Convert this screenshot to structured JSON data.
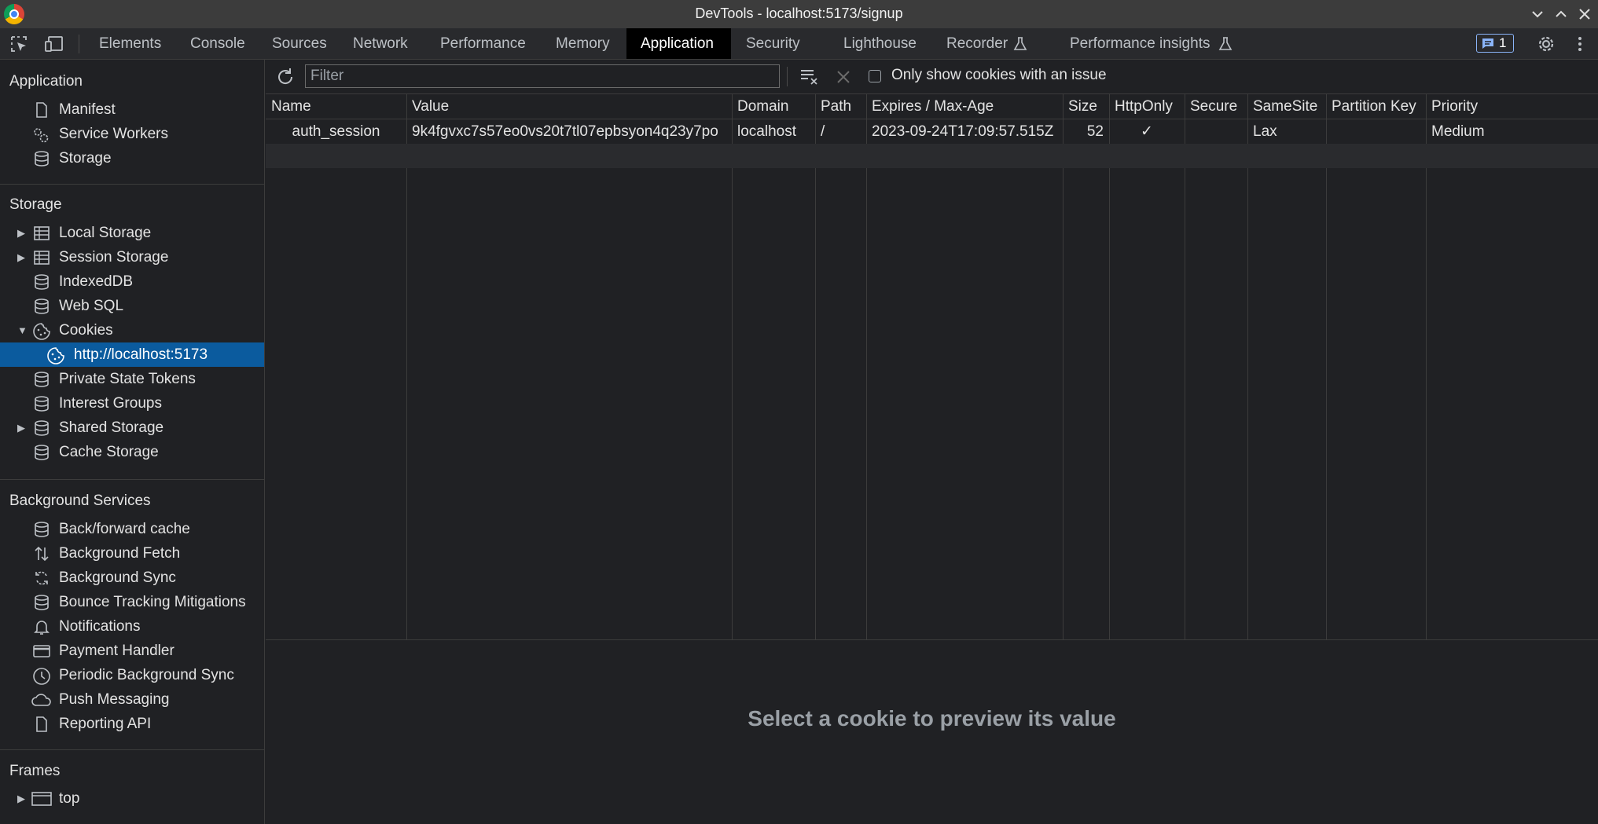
{
  "window": {
    "title": "DevTools - localhost:5173/signup"
  },
  "tabs": [
    {
      "label": "Elements"
    },
    {
      "label": "Console"
    },
    {
      "label": "Sources"
    },
    {
      "label": "Network"
    },
    {
      "label": "Performance"
    },
    {
      "label": "Memory"
    },
    {
      "label": "Application"
    },
    {
      "label": "Security"
    },
    {
      "label": "Lighthouse"
    },
    {
      "label": "Recorder"
    },
    {
      "label": "Performance insights"
    }
  ],
  "issues_badge": {
    "count": "1"
  },
  "sidebar": {
    "application": {
      "title": "Application",
      "items": [
        {
          "label": "Manifest"
        },
        {
          "label": "Service Workers"
        },
        {
          "label": "Storage"
        }
      ]
    },
    "storage": {
      "title": "Storage",
      "items": [
        {
          "label": "Local Storage"
        },
        {
          "label": "Session Storage"
        },
        {
          "label": "IndexedDB"
        },
        {
          "label": "Web SQL"
        },
        {
          "label": "Cookies"
        },
        {
          "label": "http://localhost:5173"
        },
        {
          "label": "Private State Tokens"
        },
        {
          "label": "Interest Groups"
        },
        {
          "label": "Shared Storage"
        },
        {
          "label": "Cache Storage"
        }
      ]
    },
    "background": {
      "title": "Background Services",
      "items": [
        {
          "label": "Back/forward cache"
        },
        {
          "label": "Background Fetch"
        },
        {
          "label": "Background Sync"
        },
        {
          "label": "Bounce Tracking Mitigations"
        },
        {
          "label": "Notifications"
        },
        {
          "label": "Payment Handler"
        },
        {
          "label": "Periodic Background Sync"
        },
        {
          "label": "Push Messaging"
        },
        {
          "label": "Reporting API"
        }
      ]
    },
    "frames": {
      "title": "Frames",
      "items": [
        {
          "label": "top"
        }
      ]
    }
  },
  "toolbar": {
    "filter_placeholder": "Filter",
    "only_issues_label": "Only show cookies with an issue"
  },
  "table": {
    "columns": [
      "Name",
      "Value",
      "Domain",
      "Path",
      "Expires / Max-Age",
      "Size",
      "HttpOnly",
      "Secure",
      "SameSite",
      "Partition Key",
      "Priority"
    ],
    "rows": [
      {
        "name": "auth_session",
        "value": "9k4fgvxc7s57eo0vs20t7tl07epbsyon4q23y7po",
        "domain": "localhost",
        "path": "/",
        "expires": "2023-09-24T17:09:57.515Z",
        "size": "52",
        "httponly": "✓",
        "secure": "",
        "samesite": "Lax",
        "partition_key": "",
        "priority": "Medium"
      }
    ]
  },
  "preview": {
    "message": "Select a cookie to preview its value"
  },
  "colors": {
    "selected_bg": "#0b5b9e",
    "panel_bg": "#202124",
    "active_tab_bg": "#000000",
    "badge_border": "#8ab4f8"
  }
}
